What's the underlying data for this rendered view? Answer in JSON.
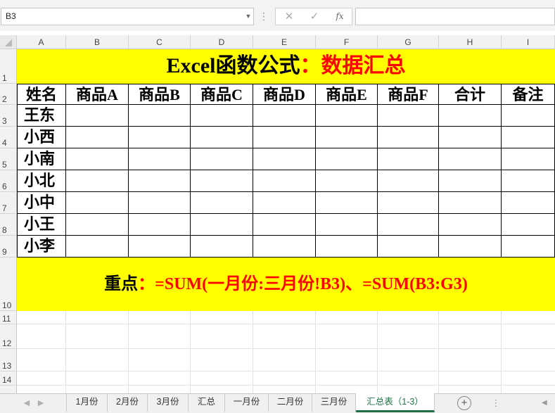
{
  "formula_bar": {
    "name_box": "B3",
    "cancel_icon": "✕",
    "enter_icon": "✓",
    "fx_label": "fx",
    "formula": ""
  },
  "columns": [
    "A",
    "B",
    "C",
    "D",
    "E",
    "F",
    "G",
    "H",
    "I"
  ],
  "rows": [
    "1",
    "2",
    "3",
    "4",
    "5",
    "6",
    "7",
    "8",
    "9",
    "10",
    "11",
    "12",
    "13",
    "14"
  ],
  "title": {
    "black": "Excel函数公式",
    "red": "：数据汇总"
  },
  "table": {
    "headers": [
      "姓名",
      "商品A",
      "商品B",
      "商品C",
      "商品D",
      "商品E",
      "商品F",
      "合计",
      "备注"
    ],
    "names": [
      "王东",
      "小西",
      "小南",
      "小北",
      "小中",
      "小王",
      "小李"
    ]
  },
  "note": {
    "label": "重点",
    "text": "：=SUM(一月份:三月份!B3)、=SUM(B3:G3)"
  },
  "sheet_tabs": [
    "1月份",
    "2月份",
    "3月份",
    "汇总",
    "一月份",
    "二月份",
    "三月份",
    "汇总表（1-3）"
  ],
  "active_tab_index": 7,
  "colors": {
    "highlight": "#ffff00",
    "red_text": "#ff0000",
    "active_tab": "#1e7145"
  }
}
